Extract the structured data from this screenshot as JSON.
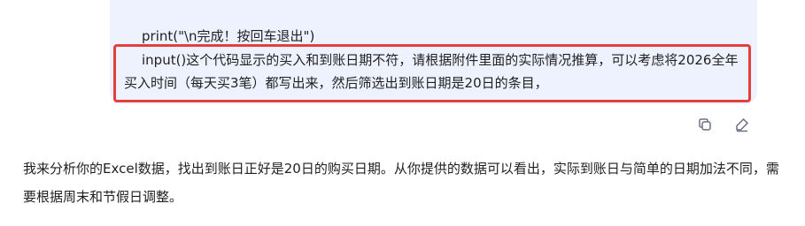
{
  "user_message": {
    "code_line": "print(\"\\n完成！按回车退出\")",
    "request_text": "input()这个代码显示的买入和到账日期不符，请根据附件里面的实际情况推算，可以考虑将2026全年买入时间（每天买3笔）都写出来，然后筛选出到账日期是20日的条目，"
  },
  "actions": {
    "copy_icon": "copy-icon",
    "edit_icon": "edit-pencil-icon"
  },
  "assistant_reply": {
    "text": "我来分析你的Excel数据，找出到账日正好是20日的购买日期。从你提供的数据可以看出，实际到账日与简单的日期加法不同，需要根据周末和节假日调整。"
  },
  "colors": {
    "bubble_bg": "#eef2ff",
    "highlight_border": "#e53e3e",
    "text": "#1f1f1f"
  }
}
